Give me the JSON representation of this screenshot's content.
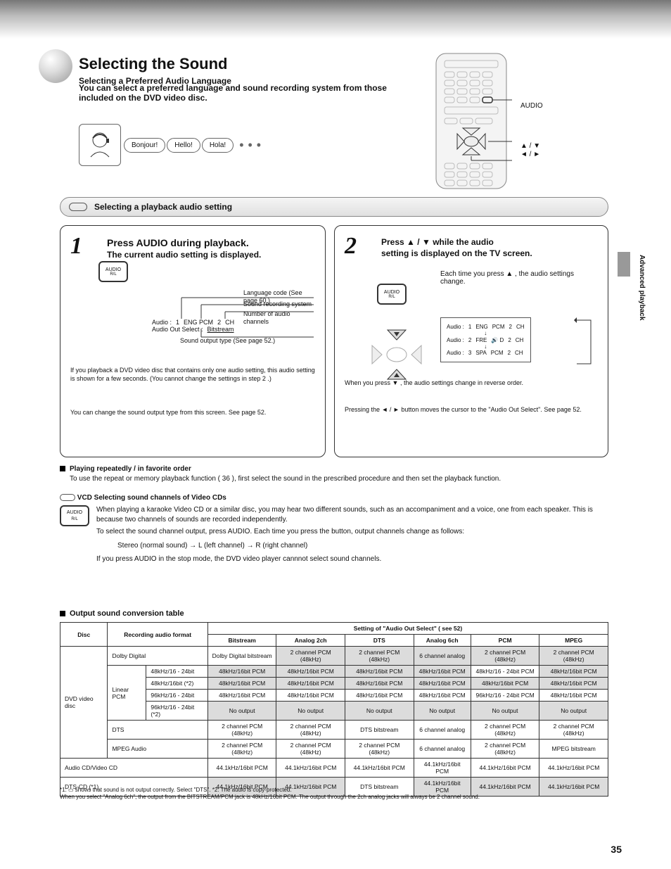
{
  "header": {
    "title_main": "Selecting the Sound",
    "title_sub": "Selecting a Preferred Audio Language",
    "intro": "You can select a preferred language and sound recording system from those included on the DVD video disc."
  },
  "bubbles": [
    "Bonjour!",
    "Hello!",
    "Hola!"
  ],
  "remote": {
    "label1": "AUDIO",
    "label2": "▲ / ▼",
    "label3": "◄ / ►"
  },
  "bar": {
    "text": "Selecting a playback audio setting"
  },
  "step1": {
    "num": "1",
    "main": "Press AUDIO during playback.",
    "sub": "The current audio setting is displayed.",
    "btn_top": "AUDIO",
    "btn_sub": "R/L",
    "osd": {
      "l1": "Audio :",
      "l2": "1",
      "l3": "ENG  PCM",
      "l4": "2",
      "l5": "CH",
      "l6": "Audio Out Select :",
      "l7": "Bitstream"
    },
    "annot": {
      "lang": "Language code (See page 60.)",
      "rec": "Sound recording system",
      "type": "Sound output type (See page 52.)",
      "ch": "Number of audio channels"
    },
    "note": "If you playback a DVD video disc that contains only one audio setting, this audio setting is shown for a few seconds. (You cannot change the settings in step  2  .)",
    "note2": "You can change the sound output type from this screen. See page 52."
  },
  "step2": {
    "num": "2",
    "main_a": "Press",
    "main_b": "/",
    "main_c": "while the audio",
    "main2": "setting is displayed on the TV screen.",
    "side": "Each time you press ▲ , the audio settings change.",
    "btn_top": "AUDIO",
    "btn_sub": "R/L",
    "osd": [
      {
        "a": "Audio :",
        "b": "1",
        "c": "ENG",
        "d": "PCM",
        "e": "2",
        "f": "CH"
      },
      {
        "a": "Audio :",
        "b": "2",
        "c": "FRE",
        "d": "🔊 D",
        "e": "2",
        "f": "CH"
      },
      {
        "a": "Audio :",
        "b": "3",
        "c": "SPA",
        "d": "PCM",
        "e": "2",
        "f": "CH"
      }
    ],
    "note1": "When you press ▼ , the audio settings change in reverse order.",
    "note2": "Pressing the ◄ / ► button moves the cursor to the \"Audio Out Select\". See page 52."
  },
  "after": {
    "head": "Playing repeatedly / in favorite order",
    "body": "To use the repeat or memory playback function ( 36 ), first select the sound in the prescribed procedure and then set the playback function.",
    "vcd_head": "VCD  Selecting sound channels of Video CDs",
    "vcd_body1": "When playing a karaoke Video CD or a similar disc, you may hear two different sounds, such as an accompaniment and a voice, one from each speaker. This is because two channels of sounds are recorded independently.",
    "vcd_body2": "To select the sound channel output, press AUDIO. Each time you press the button, output channels change as follows:",
    "seq": "Stereo (normal sound)  →  L (left channel)  →  R (right channel)",
    "vcd_note": "If you press AUDIO in the stop mode, the DVD video player cannnot select sound channels."
  },
  "table": {
    "title": "Output sound conversion table",
    "header": {
      "disc": "Disc",
      "rec": "Recording audio format",
      "setting_head": "Setting of \"Audio Out Select\" ( see 52)",
      "cols": [
        "Bitstream",
        "Analog 2ch",
        "DTS",
        "Analog 6ch",
        "PCM",
        "MPEG"
      ]
    },
    "rows": [
      {
        "disc": "DVD video disc",
        "sub": "Dolby Digital",
        "fmt": "",
        "c": [
          "Dolby Digital bitstream",
          "2 channel PCM (48kHz)",
          "2 channel PCM (48kHz)",
          "6 channel analog",
          "2 channel PCM (48kHz)",
          "2 channel PCM (48kHz)"
        ],
        "shade": [
          0,
          1,
          1,
          1,
          1,
          1
        ]
      },
      {
        "disc": "",
        "sub": "",
        "fmt": "48kHz/16 - 24bit",
        "c": [
          "48kHz/16bit PCM",
          "48kHz/16bit PCM",
          "48kHz/16bit PCM",
          "48kHz/16bit PCM",
          "48kHz/16 - 24bit PCM",
          "48kHz/16bit PCM"
        ],
        "shade": [
          1,
          1,
          1,
          1,
          0,
          1
        ]
      },
      {
        "disc": "",
        "sub": "Linear PCM",
        "fmt": "48kHz/16bit (*2)",
        "c": [
          "48kHz/16bit PCM",
          "48kHz/16bit PCM",
          "48kHz/16bit PCM",
          "48kHz/16bit PCM",
          "48kHz/16bit PCM",
          "48kHz/16bit PCM"
        ],
        "shade": [
          1,
          1,
          1,
          1,
          1,
          1
        ]
      },
      {
        "disc": "",
        "sub": "",
        "fmt": "96kHz/16 - 24bit",
        "c": [
          "48kHz/16bit PCM",
          "48kHz/16bit PCM",
          "48kHz/16bit PCM",
          "48kHz/16bit PCM",
          "96kHz/16 - 24bit PCM",
          "48kHz/16bit PCM"
        ],
        "shade": [
          0,
          0,
          0,
          0,
          0,
          0
        ]
      },
      {
        "disc": "",
        "sub": "",
        "fmt": "96kHz/16 - 24bit (*2)",
        "c": [
          "No output",
          "No output",
          "No output",
          "No output",
          "No output",
          "No output"
        ],
        "shade": [
          1,
          1,
          1,
          1,
          1,
          1
        ]
      },
      {
        "disc": "",
        "sub": "DTS",
        "fmt": "",
        "c": [
          "2 channel PCM (48kHz)",
          "2 channel PCM (48kHz)",
          "DTS bitstream",
          "6 channel analog",
          "2 channel PCM (48kHz)",
          "2 channel PCM (48kHz)"
        ],
        "shade": [
          0,
          0,
          0,
          0,
          0,
          0
        ]
      },
      {
        "disc": "",
        "sub": "MPEG Audio",
        "fmt": "",
        "c": [
          "2 channel PCM (48kHz)",
          "2 channel PCM (48kHz)",
          "2 channel PCM (48kHz)",
          "6 channel analog",
          "2 channel PCM (48kHz)",
          "MPEG bitstream"
        ],
        "shade": [
          0,
          0,
          0,
          0,
          0,
          0
        ]
      },
      {
        "disc": "Audio CD/Video CD",
        "sub": "",
        "fmt": "",
        "c": [
          "44.1kHz/16bit PCM",
          "44.1kHz/16bit PCM",
          "44.1kHz/16bit PCM",
          "44.1kHz/16bit PCM",
          "44.1kHz/16bit PCM",
          "44.1kHz/16bit PCM"
        ],
        "shade": [
          0,
          0,
          0,
          0,
          0,
          0
        ]
      },
      {
        "disc": "DTS-CD (*1)",
        "sub": "",
        "fmt": "",
        "c": [
          "44.1kHz/16bit PCM",
          "44.1kHz/16bit PCM",
          "DTS bitstream",
          "44.1kHz/16bit PCM",
          "44.1kHz/16bit PCM",
          "44.1kHz/16bit PCM"
        ],
        "shade": [
          1,
          1,
          0,
          1,
          1,
          1
        ]
      }
    ],
    "footnote": "*1: ▭ shows that sound is not output correctly. Select \"DTS\".  *2: The audio is copy-protected.\nWhen you select \"Analog 6ch\", the output from the BITSTREAM/PCM jack is 48kHz/16bit PCM.  The output through the 2ch analog jacks will always be 2 channel sound."
  },
  "pagenum": "35",
  "side": "Advanced playback"
}
